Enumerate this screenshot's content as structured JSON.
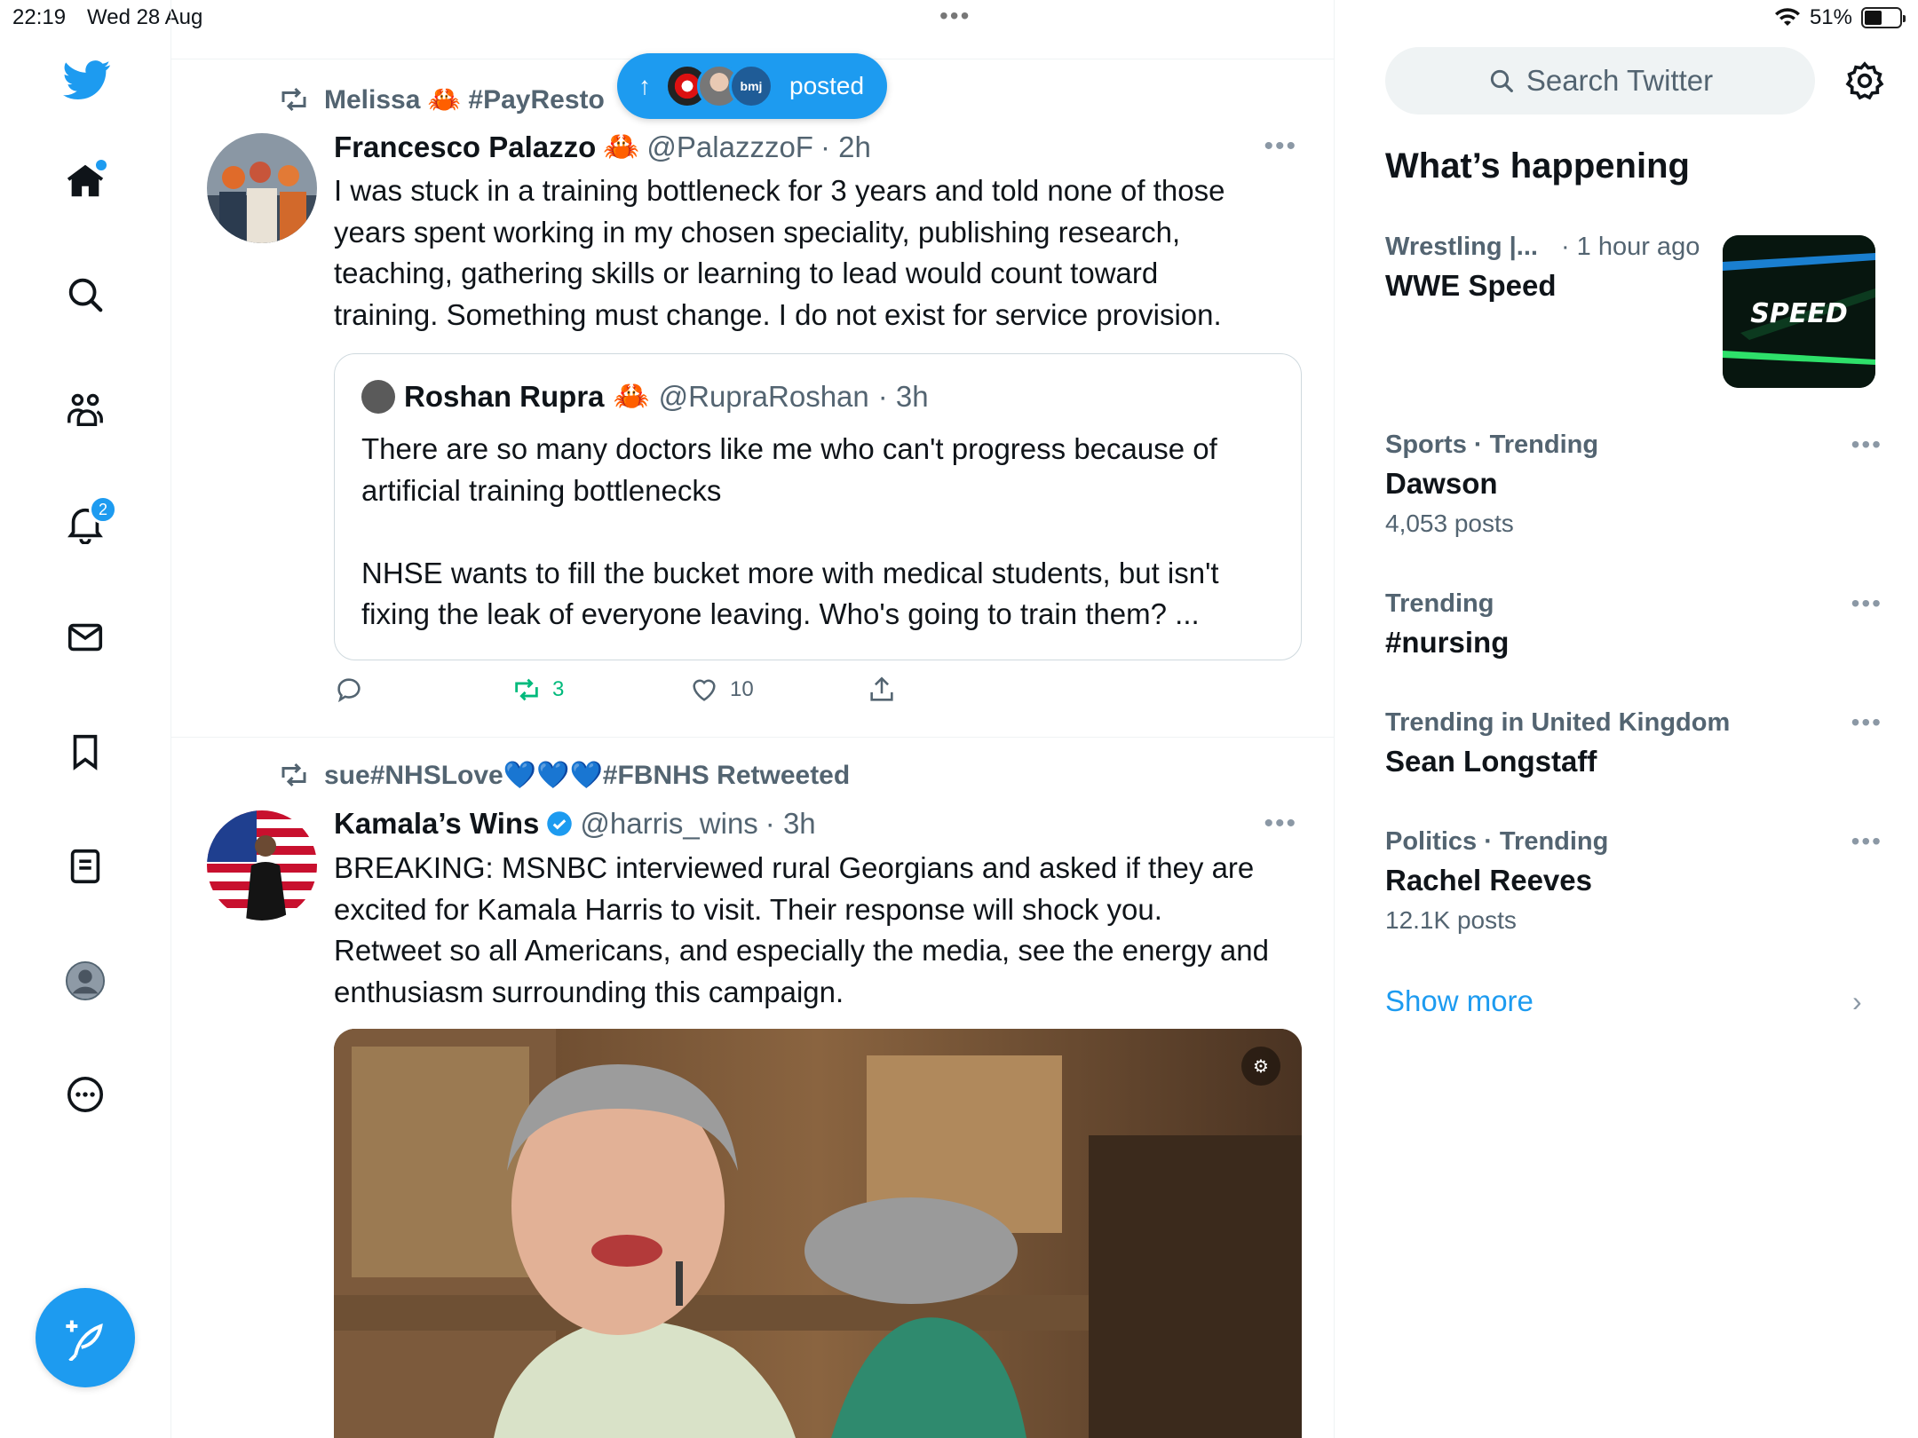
{
  "statusbar": {
    "time": "22:19",
    "date": "Wed 28 Aug",
    "battery": "51%",
    "battery_level": 0.51
  },
  "nav": {
    "notifications_badge": "2",
    "compose_label": "Post"
  },
  "new_posts_pill": {
    "label": "posted",
    "avatar_badge": "bmj"
  },
  "tweets": [
    {
      "retweeted_by": "Melissa 🦀 #PayResto",
      "name": "Francesco Palazzo",
      "name_emoji": "🦀",
      "handle": "@PalazzzoF",
      "time": "· 2h",
      "body": "I was stuck in a training bottleneck for 3 years and told none of those\nyears spent working in my chosen speciality, publishing research,\nteaching, gathering skills or learning to lead would count toward\ntraining. Something must change. I do not exist for service provision.",
      "quote": {
        "name": "Roshan Rupra",
        "name_emoji": "🦀",
        "handle": "@RupraRoshan",
        "time": "· 3h",
        "body": "There are so many doctors like me who can't progress because of\nartificial training bottlenecks\n\nNHSE wants to fill the bucket more with medical students, but isn't\nfixing the leak of everyone leaving. Who's going to train them? ..."
      },
      "retweets": "3",
      "likes": "10"
    },
    {
      "retweeted_by": "sue#NHSLove💙💙💙#FBNHS Retweeted",
      "name": "Kamala’s Wins",
      "handle": "@harris_wins",
      "time": "· 3h",
      "body": "BREAKING: MSNBC interviewed rural Georgians and asked if they are\nexcited for Kamala Harris to visit. Their response will shock you.\nRetweet so all Americans, and especially the media, see the energy and\nenthusiasm surrounding this campaign."
    }
  ],
  "right": {
    "search_placeholder": "Search Twitter",
    "whats_happening": "What’s happening",
    "trends": [
      {
        "meta": "Wrestling |...",
        "meta_extra": "· 1 hour ago",
        "name": "WWE Speed",
        "posts": "",
        "image_text": "SPEED"
      },
      {
        "meta": "Sports · Trending",
        "name": "Dawson",
        "posts": "4,053 posts"
      },
      {
        "meta": "Trending",
        "name": "#nursing",
        "posts": ""
      },
      {
        "meta": "Trending in United Kingdom",
        "name": "Sean Longstaff",
        "posts": ""
      },
      {
        "meta": "Politics · Trending",
        "name": "Rachel Reeves",
        "posts": "12.1K posts"
      }
    ],
    "show_more": "Show more"
  },
  "colors": {
    "accent": "#1d9bf0",
    "retweet_green": "#00ba7c",
    "muted": "#536471"
  }
}
